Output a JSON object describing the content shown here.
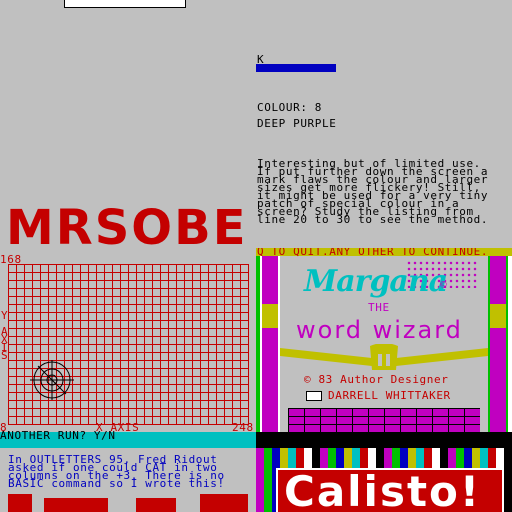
{
  "top_right": {
    "k_label": "K",
    "colour_line": "COLOUR: 8",
    "colour_name": "DEEP PURPLE",
    "paragraph": "Interesting but of limited use.\nIf put further down the screen a\nmark flaws the colour and larger\nsizes get more flickery! Still,\nit might be used for a very tiny\npatch of special colour in a\nscreen? Study the listing from\nline 20 to 30 to see the method."
  },
  "graph": {
    "title": "MRSOBE",
    "y_top": "168",
    "y_axis_letters": [
      "Y",
      "A",
      "X",
      "I",
      "S"
    ],
    "x_start": "8",
    "x_axis": "X AXIS",
    "x_end": "248",
    "prompt": "ANOTHER RUN? Y/N"
  },
  "outletters": {
    "text": "In OUTLETTERS 95, Fred Ridout\nasked if one could CAT in two\ncolumns on the +3. There is no\nBASIC command so I wrote this!"
  },
  "margana": {
    "menu": "Q TO QUIT.ANY OTHER TO CONTINUE.",
    "logo": "Margana",
    "logo_mark": "©",
    "the": "THE",
    "subtitle": "word wizard",
    "copyright": "© 83 Author Designer",
    "author": "DARRELL WHITTAKER",
    "tape_icon": "cassette-icon"
  },
  "calisto": {
    "title": "Calisto!"
  },
  "colors": {
    "background": "#c0c0c0",
    "red": "#c40000",
    "blue": "#0000c0",
    "cyan": "#00c0c0",
    "magenta": "#c000c0",
    "yellow": "#c0c000"
  }
}
